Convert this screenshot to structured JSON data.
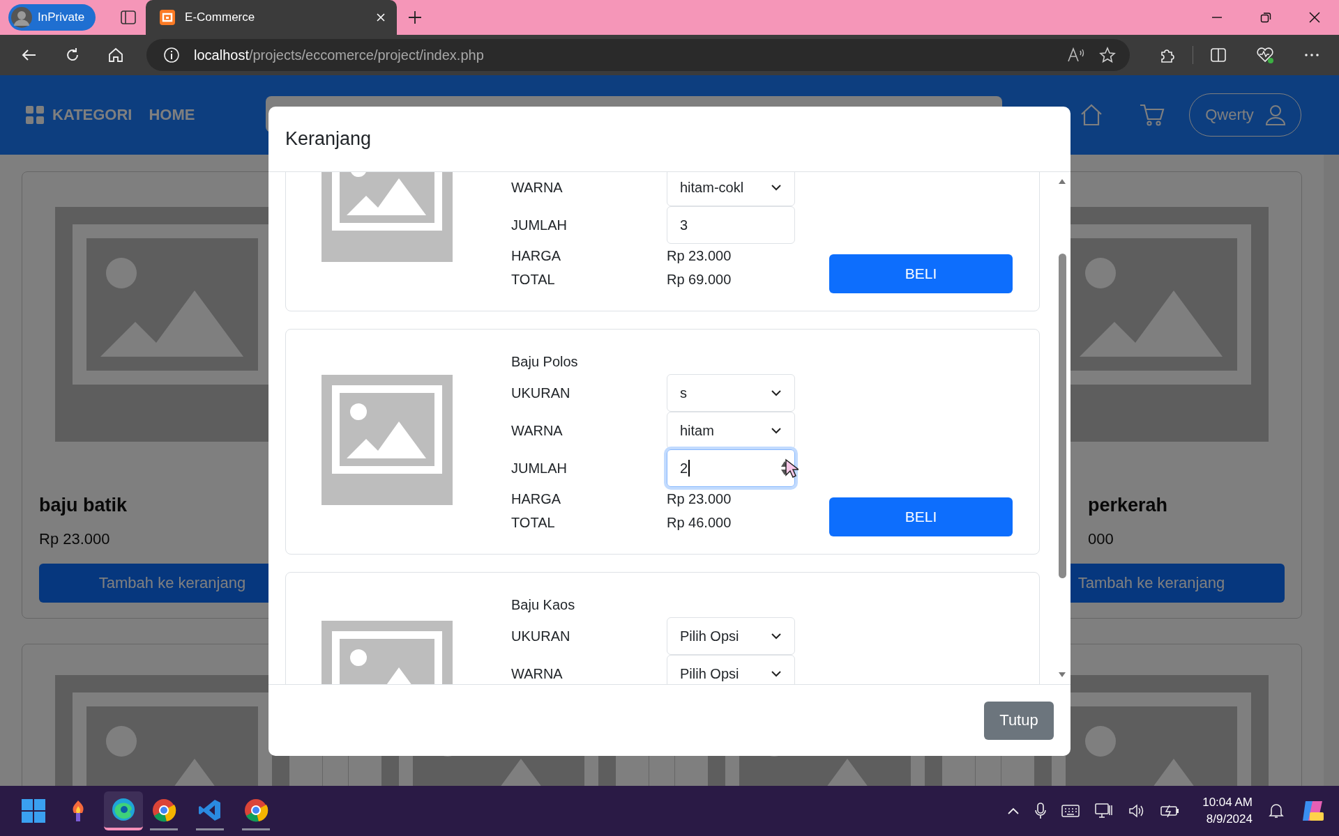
{
  "browser": {
    "profile": "InPrivate",
    "tabs": [
      {
        "title": "E-Commerce",
        "selected": true
      }
    ],
    "url_host": "localhost",
    "url_path": "/projects/eccomerce/project/index.php"
  },
  "navbar": {
    "items": [
      "KATEGORI",
      "HOME"
    ],
    "user": "Qwerty"
  },
  "products": [
    {
      "name": "baju batik",
      "price": "Rp 23.000",
      "button": "Tambah ke keranjang"
    },
    {
      "name": "perkerah",
      "price": "000",
      "button": "Tambah ke keranjang"
    }
  ],
  "modal": {
    "title": "Keranjang",
    "items": [
      {
        "fields": [
          {
            "kind": "select",
            "label": "WARNA",
            "value": "hitam-cokl"
          },
          {
            "kind": "number",
            "label": "JUMLAH",
            "value": "3",
            "focused": false
          },
          {
            "kind": "text",
            "label": "HARGA",
            "value": "Rp 23.000"
          },
          {
            "kind": "text",
            "label": "TOTAL",
            "value": "Rp 69.000"
          }
        ],
        "button": "BELI"
      },
      {
        "name": "Baju Polos",
        "fields": [
          {
            "kind": "select",
            "label": "UKURAN",
            "value": "s"
          },
          {
            "kind": "select",
            "label": "WARNA",
            "value": "hitam"
          },
          {
            "kind": "number",
            "label": "JUMLAH",
            "value": "2",
            "focused": true
          },
          {
            "kind": "text",
            "label": "HARGA",
            "value": "Rp 23.000"
          },
          {
            "kind": "text",
            "label": "TOTAL",
            "value": "Rp 46.000"
          }
        ],
        "button": "BELI"
      },
      {
        "name": "Baju Kaos",
        "fields": [
          {
            "kind": "select",
            "label": "UKURAN",
            "value": "Pilih Opsi"
          },
          {
            "kind": "select",
            "label": "WARNA",
            "value": "Pilih Opsi"
          }
        ]
      }
    ],
    "close_button": "Tutup"
  },
  "taskbar": {
    "time": "10:04 AM",
    "date": "8/9/2024"
  }
}
